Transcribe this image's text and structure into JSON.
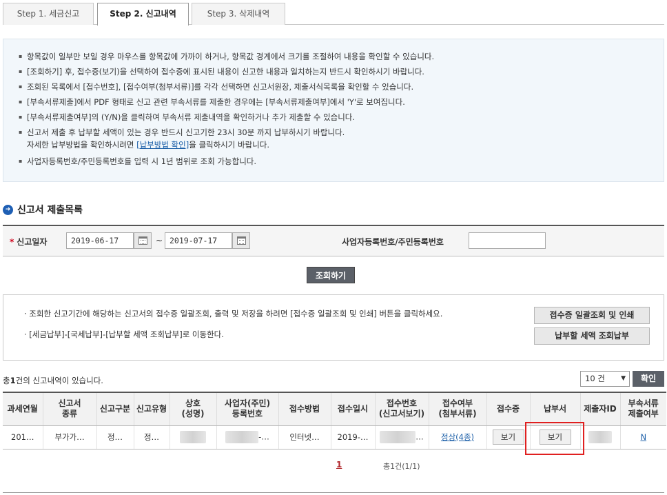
{
  "tabs": [
    {
      "label": "Step 1. 세금신고"
    },
    {
      "label": "Step 2. 신고내역"
    },
    {
      "label": "Step 3. 삭제내역"
    }
  ],
  "notice": {
    "items": [
      "항목값이 일부만 보일 경우 마우스를 항목값에 가까이 하거나, 항목값 경계에서 크기를 조절하여 내용을 확인할 수 있습니다.",
      "[조회하기] 후, 접수증(보기)을 선택하여 접수증에 표시된 내용이 신고한 내용과 일치하는지 반드시 확인하시기 바랍니다.",
      "조회된 목록에서 [접수번호], [접수여부(첨부서류)]를 각각 선택하면 신고서원장, 제출서식목록을 확인할 수 있습니다.",
      "[부속서류제출]에서 PDF 형태로 신고 관련 부속서류를 제출한 경우에는 [부속서류제출여부]에서 'Y'로 보여집니다.",
      "[부속서류제출여부]의 (Y/N)을 클릭하여 부속서류 제출내역을 확인하거나 추가 제출할 수 있습니다.",
      "신고서 제출 후 납부할 세액이 있는 경우 반드시 신고기한 23시 30분 까지 납부하시기 바랍니다."
    ],
    "payment_line_prefix": "자세한 납부방법을 확인하시려면 ",
    "payment_link": "[납부방법 확인]",
    "payment_line_suffix": "을 클릭하시기 바랍니다.",
    "last_item": "사업자등록번호/주민등록번호를 입력 시 1년 범위로 조회 가능합니다."
  },
  "section": {
    "title": "신고서 제출목록"
  },
  "search": {
    "required_mark": "*",
    "date_label": "신고일자",
    "date_from": "2019-06-17",
    "tilde": "~",
    "date_to": "2019-07-17",
    "biz_label": "사업자등록번호/주민등록번호",
    "biz_value": "",
    "search_button": "조회하기"
  },
  "info": {
    "line1": "· 조회한 신고기간에 해당하는 신고서의 접수증 일괄조회, 출력 및 저장을 하려면 [접수증 일괄조회 및 인쇄] 버튼을 클릭하세요.",
    "line2": "· [세금납부]-[국세납부]-[납부할 세액 조회납부]로 이동한다.",
    "btn_batch": "접수증 일괄조회 및 인쇄",
    "btn_pay": "납부할 세액 조회납부"
  },
  "results": {
    "count_prefix": "총",
    "count": "1",
    "count_suffix": "건의 신고내역이 있습니다.",
    "page_size": "10 건",
    "confirm_button": "확인",
    "headers": [
      [
        "과세연월",
        ""
      ],
      [
        "신고서",
        "종류"
      ],
      [
        "신고구분",
        ""
      ],
      [
        "신고유형",
        ""
      ],
      [
        "상호",
        "(성명)"
      ],
      [
        "사업자(주민)",
        "등록번호"
      ],
      [
        "접수방법",
        ""
      ],
      [
        "접수일시",
        ""
      ],
      [
        "접수번호",
        "(신고서보기)"
      ],
      [
        "접수여부",
        "(첨부서류)"
      ],
      [
        "접수증",
        ""
      ],
      [
        "납부서",
        ""
      ],
      [
        "제출자ID",
        ""
      ],
      [
        "부속서류",
        "제출여부"
      ]
    ],
    "row": {
      "period": "201…",
      "form_type": "부가가…",
      "report_div": "정…",
      "report_type": "정…",
      "reg_no_suffix": "-…",
      "method": "인터넷…",
      "received_at": "2019-…",
      "receipt_no_suffix": "…",
      "status_link": "정상(4종)",
      "receipt_btn": "보기",
      "payment_btn": "보기",
      "attach_flag": "N"
    }
  },
  "pagination": {
    "current": "1",
    "info": "총1건(1/1)"
  },
  "colors": {
    "accent": "#1e5fb4",
    "highlight": "#e02020",
    "dark_button": "#5b6068",
    "notice_bg": "#f2f7fb"
  }
}
